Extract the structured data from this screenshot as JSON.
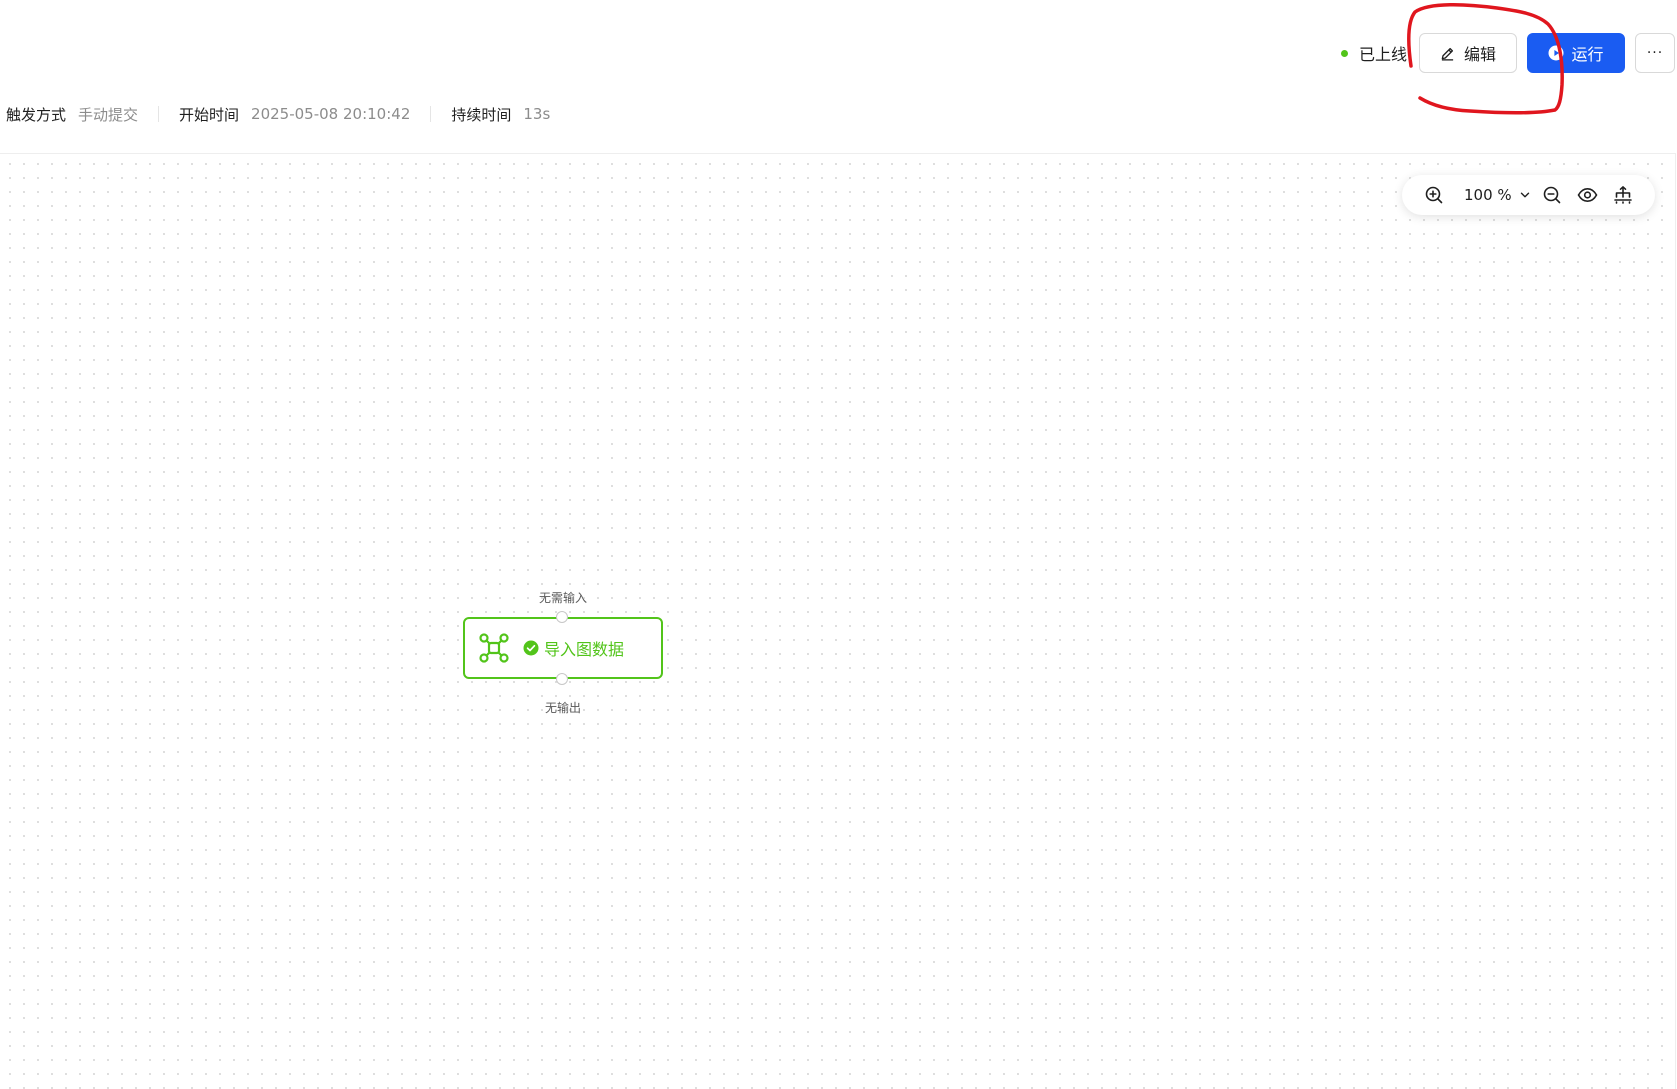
{
  "header": {
    "status": {
      "label": "已上线",
      "color": "#52c41a"
    },
    "edit_button": {
      "label": "编辑",
      "icon": "pencil-icon"
    },
    "run_button": {
      "label": "运行",
      "icon": "play-circle-icon",
      "color": "#1a5cf2"
    },
    "more_button": {
      "label": "···",
      "icon": "more-icon"
    },
    "info": {
      "trigger_label": "触发方式",
      "trigger_value": "手动提交",
      "start_label": "开始时间",
      "start_value": "2025-05-08 20:10:42",
      "duration_label": "持续时间",
      "duration_value": "13s"
    }
  },
  "canvas": {
    "zoom": {
      "zoom_in_icon": "zoom-in-icon",
      "level": "100 %",
      "zoom_out_icon": "zoom-out-icon",
      "preview_icon": "eye-icon",
      "layout_icon": "auto-layout-icon"
    },
    "node": {
      "title": "导入图数据",
      "input_label": "无需输入",
      "output_label": "无输出",
      "status": "success",
      "color": "#52c41a",
      "icon": "graph-nodes-icon"
    }
  },
  "annotation": {
    "color": "#e0161e"
  }
}
